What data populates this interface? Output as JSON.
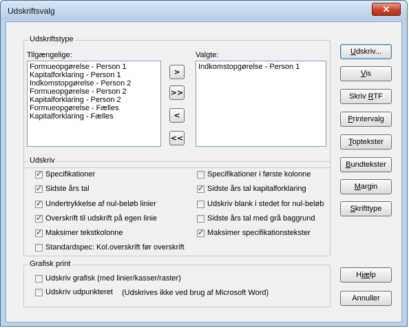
{
  "window": {
    "title": "Udskriftsvalg",
    "close_glyph": "✕"
  },
  "print_type": {
    "group_title": "Udskriftstype",
    "available_label": "Tilgængelige:",
    "selected_label": "Valgte:",
    "available_items": [
      "Formueopgørelse - Person 1",
      "Kapitalforklaring - Person 1",
      "Indkomstopgørelse - Person 2",
      "Formueopgørelse - Person 2",
      "Kapitalforklaring - Person 2",
      "Formueopgørelse - Fælles",
      "Kapitalforklaring - Fælles"
    ],
    "selected_items": [
      "Indkomstopgørelse - Person 1"
    ],
    "move_buttons": {
      "add": ">",
      "add_all": ">>",
      "remove": "<",
      "remove_all": "<<"
    }
  },
  "print_options": {
    "group_title": "Udskriv",
    "left": [
      {
        "label": "Specifikationer",
        "checked": true
      },
      {
        "label": "Sidste års tal",
        "checked": true
      },
      {
        "label": "Undertrykkelse af nul-beløb linier",
        "checked": true
      },
      {
        "label": "Overskrift til udskrift på egen linie",
        "checked": true
      },
      {
        "label": "Maksimer tekstkolonne",
        "checked": true
      },
      {
        "label": "Standardspec: Kol.overskrift før overskrift",
        "checked": false
      }
    ],
    "right": [
      {
        "label": "Specifikationer i første kolonne",
        "checked": false
      },
      {
        "label": "Sidste års tal kapitalforklaring",
        "checked": true
      },
      {
        "label": "Udskriv blank i stedet for nul-beløb",
        "checked": false
      },
      {
        "label": "Sidste års tal med grå baggrund",
        "checked": false
      },
      {
        "label": "Maksimer specifikationstekster",
        "checked": true
      }
    ]
  },
  "graphic_print": {
    "group_title": "Grafisk print",
    "options": [
      {
        "label": "Udskriv grafisk (med linier/kasser/raster)",
        "checked": false
      },
      {
        "label": "Udskriv udpunkteret",
        "checked": false
      }
    ],
    "note": "(Udskrives ikke ved brug af Microsoft Word)"
  },
  "side_buttons": {
    "print": {
      "pre": "",
      "key": "U",
      "post": "dskriv..."
    },
    "view": {
      "pre": "",
      "key": "V",
      "post": "is"
    },
    "rtf": {
      "pre": "Skriv ",
      "key": "R",
      "post": "TF"
    },
    "printer": {
      "pre": "",
      "key": "P",
      "post": "rintervalg"
    },
    "header": {
      "pre": "",
      "key": "T",
      "post": "optekster"
    },
    "footer": {
      "pre": "",
      "key": "B",
      "post": "undtekster"
    },
    "margin": {
      "pre": "",
      "key": "M",
      "post": "argin"
    },
    "font": {
      "pre": "",
      "key": "S",
      "post": "krifttype"
    },
    "help": {
      "pre": "Hj",
      "key": "æ",
      "post": "lp"
    },
    "cancel": {
      "pre": "Annuller",
      "key": "",
      "post": ""
    }
  }
}
